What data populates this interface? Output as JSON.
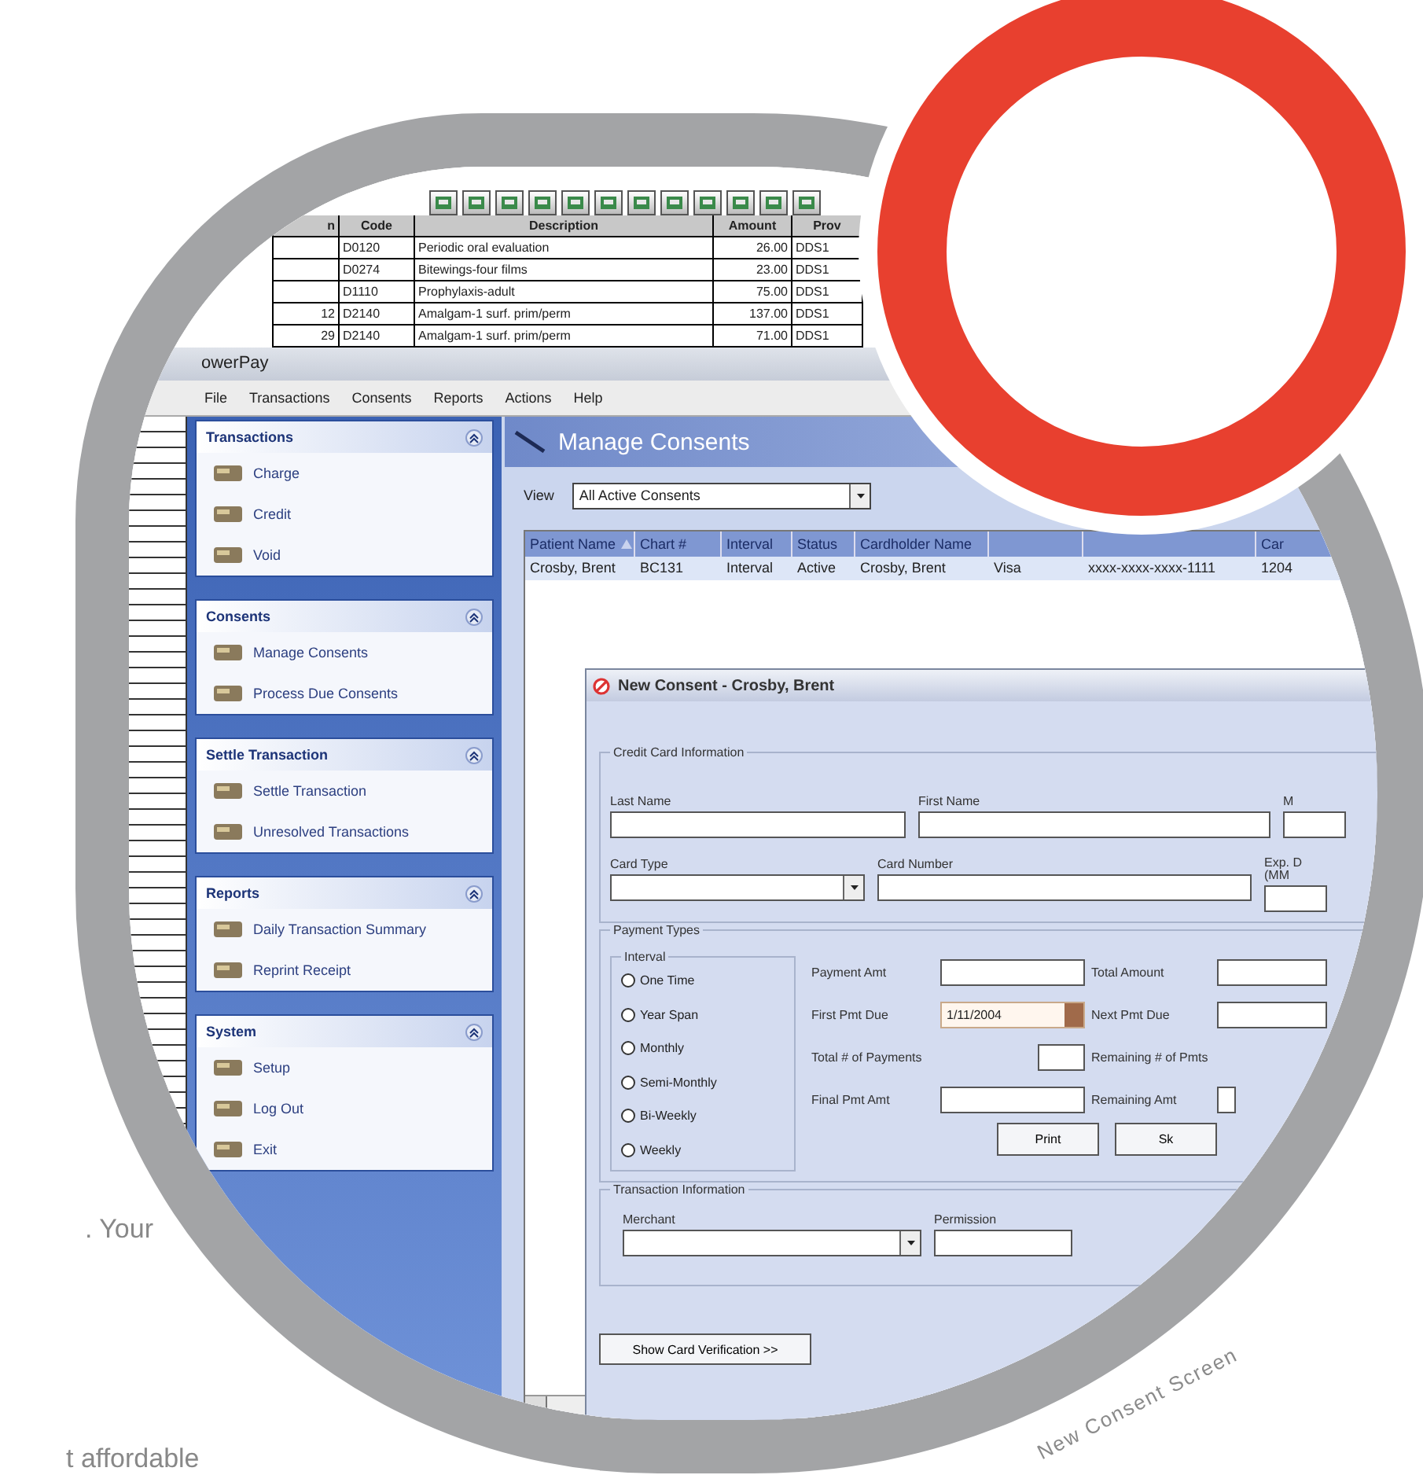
{
  "legacy": {
    "columns": [
      {
        "label": "n"
      },
      {
        "label": "Code"
      },
      {
        "label": "Description"
      },
      {
        "label": "Amount"
      },
      {
        "label": "Prov"
      }
    ],
    "rows": [
      {
        "code": "D0120",
        "description": "Periodic oral evaluation",
        "amount": "26.00",
        "provider": "DDS1"
      },
      {
        "code": "D0274",
        "description": "Bitewings-four films",
        "amount": "23.00",
        "provider": "DDS1"
      },
      {
        "code": "D1110",
        "description": "Prophylaxis-adult",
        "amount": "75.00",
        "provider": "DDS1"
      },
      {
        "qty": "12",
        "code": "D2140",
        "description": "Amalgam-1 surf. prim/perm",
        "amount": "137.00",
        "provider": "DDS1"
      },
      {
        "qty": "29",
        "code": "D2140",
        "description": "Amalgam-1 surf. prim/perm",
        "amount": "71.00",
        "provider": "DDS1"
      }
    ]
  },
  "window": {
    "title": "owerPay"
  },
  "menu": [
    "File",
    "Transactions",
    "Consents",
    "Reports",
    "Actions",
    "Help"
  ],
  "sidebar": {
    "groups": [
      {
        "title": "Transactions",
        "expanded": true,
        "items": [
          "Charge",
          "Credit",
          "Void"
        ]
      },
      {
        "title": "Consents",
        "expanded": true,
        "items": [
          "Manage Consents",
          "Process Due Consents"
        ]
      },
      {
        "title": "Settle Transaction",
        "expanded": true,
        "items": [
          "Settle Transaction",
          "Unresolved Transactions"
        ]
      },
      {
        "title": "Reports",
        "expanded": true,
        "items": [
          "Daily Transaction Summary",
          "Reprint Receipt"
        ]
      },
      {
        "title": "System",
        "expanded": true,
        "items": [
          "Setup",
          "Log Out",
          "Exit"
        ]
      }
    ]
  },
  "manage": {
    "title": "Manage Consents",
    "view_label": "View",
    "view_value": "All Active Consents",
    "columns": [
      {
        "label": "Patient Name",
        "sorted": true
      },
      {
        "label": "Chart #",
        "sorted": false
      },
      {
        "label": "Interval",
        "sorted": false
      },
      {
        "label": "Status",
        "sorted": false
      },
      {
        "label": "Cardholder Name",
        "sorted": false
      },
      {},
      {},
      {
        "label": "Car",
        "sorted": false
      }
    ],
    "rows": [
      {
        "selected": true,
        "cells": [
          "Crosby, Brent",
          "BC131",
          "Interval",
          "Active",
          "Crosby, Brent",
          "Visa",
          "xxxx-xxxx-xxxx-1111",
          "1204"
        ]
      }
    ]
  },
  "dialog": {
    "title": "New Consent - Crosby, Brent",
    "credit_card": {
      "legend": "Credit Card Information",
      "last_name": "Last Name",
      "first_name": "First Name",
      "middle": "M",
      "card_type": "Card Type",
      "card_number": "Card Number",
      "exp": "Exp. D (MM"
    },
    "payment": {
      "legend": "Payment Types",
      "interval_legend": "Interval",
      "intervals": [
        {
          "label": "One Time",
          "selected": false
        },
        {
          "label": "Year Span",
          "selected": false
        },
        {
          "label": "Monthly",
          "selected": false
        },
        {
          "label": "Semi-Monthly",
          "selected": false
        },
        {
          "label": "Bi-Weekly",
          "selected": false
        },
        {
          "label": "Weekly",
          "selected": false
        }
      ],
      "payment_amt": "Payment Amt",
      "total_amount": "Total Amount",
      "first_due": "First Pmt Due",
      "first_due_value": "1/11/2004",
      "next_due": "Next Pmt Due",
      "total_payments": "Total # of Payments",
      "remaining_pmts": "Remaining # of Pmts",
      "final_amt": "Final Pmt Amt",
      "remaining_amt": "Remaining Amt",
      "buttons": [
        "Print",
        "Sk"
      ]
    },
    "transaction": {
      "legend": "Transaction Information",
      "merchant": "Merchant",
      "permission": "Permission"
    },
    "verify_button": "Show Card Verification  >>"
  },
  "caption": "New Consent Screen",
  "side_text": [
    ". Your",
    "t affordable"
  ]
}
